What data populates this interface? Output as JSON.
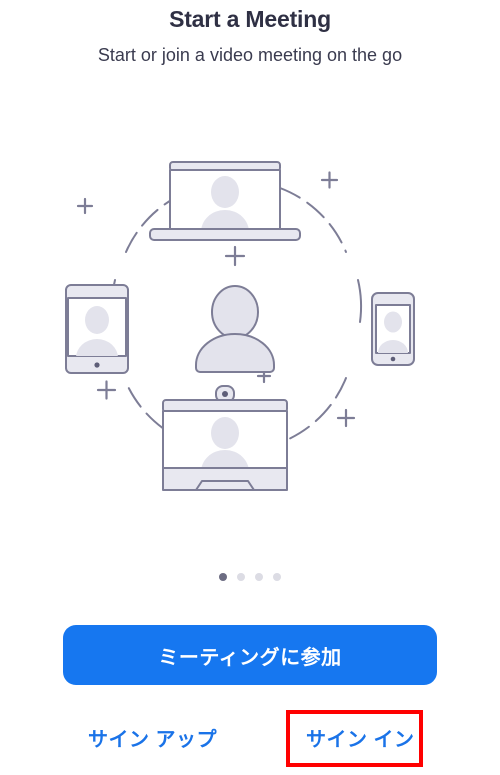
{
  "header": {
    "title": "Start a Meeting",
    "subtitle": "Start or join a video meeting on the go"
  },
  "illustration": {
    "name": "video-meeting-devices-illustration",
    "description": "Central person surrounded by a dashed circle with a laptop, tablet, smartphone and monitor, plus sparkle marks",
    "devices": [
      {
        "name": "laptop",
        "position": "top"
      },
      {
        "name": "tablet",
        "position": "left"
      },
      {
        "name": "smartphone",
        "position": "right"
      },
      {
        "name": "monitor",
        "position": "bottom"
      }
    ],
    "colors": {
      "outline": "#7d7d96",
      "avatar_fill": "#e3e3ec",
      "screen_fill": "#ffffff",
      "device_bar_fill": "#e8e8f0",
      "dash_circle": "#7d7d96"
    }
  },
  "pager": {
    "name": "onboarding-pager",
    "total_dots": 4,
    "active_index": 0,
    "active_color": "#6c6c82",
    "inactive_color": "#dcdce4"
  },
  "actions": {
    "join_meeting_label": "ミーティングに参加",
    "join_meeting_color": "#1677f0",
    "sign_up_label": "サイン アップ",
    "sign_in_label": "サイン イン",
    "link_color": "#1a73e8",
    "highlight_color": "#ff0000"
  }
}
